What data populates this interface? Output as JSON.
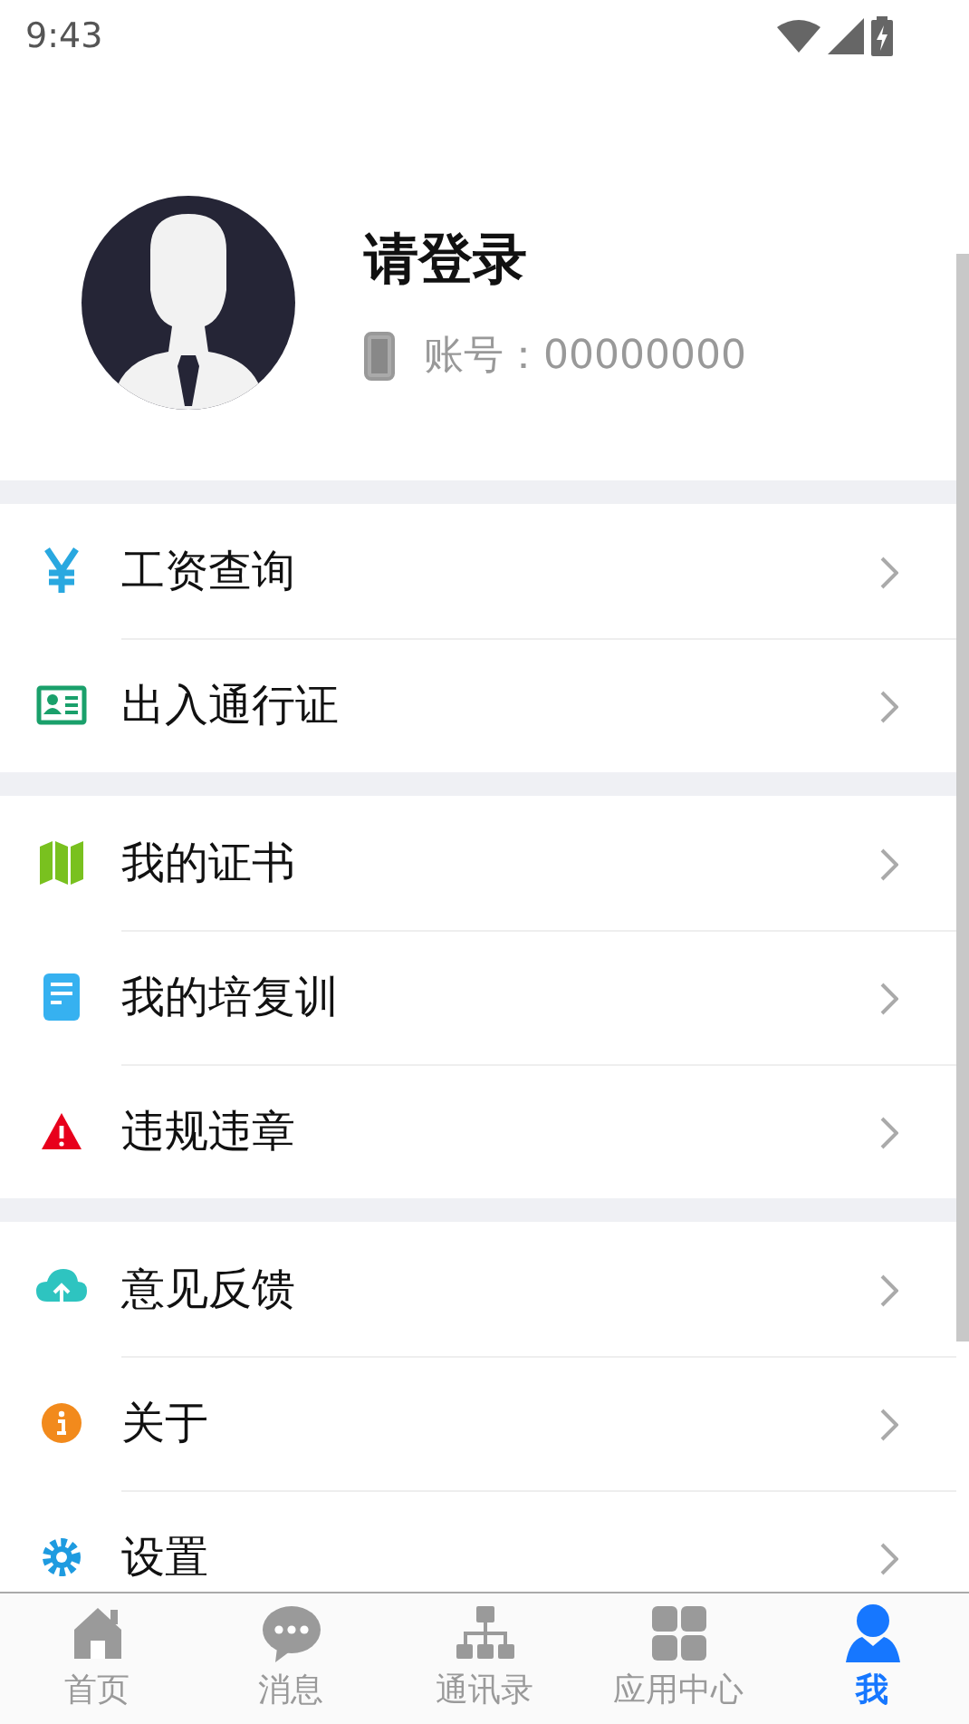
{
  "status_bar": {
    "time": "9:43"
  },
  "profile": {
    "name": "请登录",
    "account_label": "账号：",
    "account": "00000000"
  },
  "menu_groups": [
    {
      "items": [
        {
          "kind": "yen",
          "label": "工资查询"
        },
        {
          "kind": "id-card",
          "label": "出入通行证"
        }
      ]
    },
    {
      "items": [
        {
          "kind": "map",
          "label": "我的证书"
        },
        {
          "kind": "document",
          "label": "我的培复训"
        },
        {
          "kind": "warning",
          "label": "违规违章"
        }
      ]
    },
    {
      "items": [
        {
          "kind": "cloud",
          "label": "意见反馈"
        },
        {
          "kind": "info",
          "label": "关于"
        },
        {
          "kind": "gear",
          "label": "设置"
        }
      ]
    }
  ],
  "tab_bar": [
    {
      "kind": "home",
      "label": "首页",
      "selected": false
    },
    {
      "kind": "chat",
      "label": "消息",
      "selected": false
    },
    {
      "kind": "org",
      "label": "通讯录",
      "selected": false
    },
    {
      "kind": "apps",
      "label": "应用中心",
      "selected": false
    },
    {
      "kind": "user",
      "label": "我",
      "selected": true
    }
  ]
}
